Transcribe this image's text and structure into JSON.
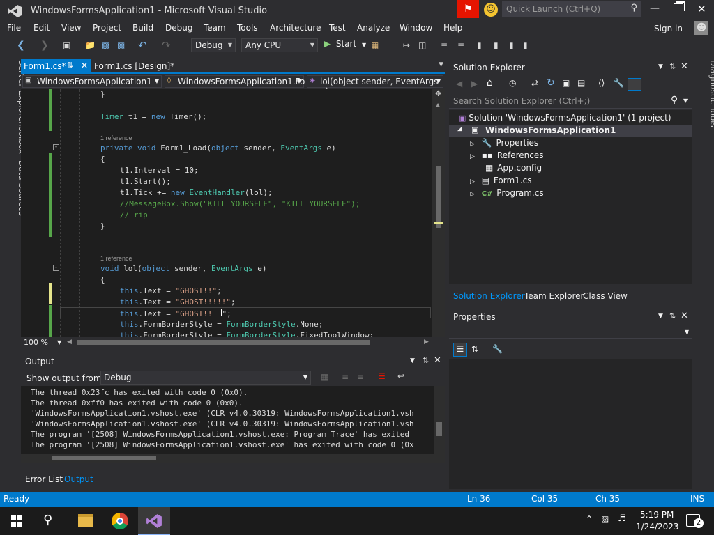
{
  "window": {
    "title": "WindowsFormsApplication1 - Microsoft Visual Studio",
    "quick_launch_placeholder": "Quick Launch (Ctrl+Q)",
    "sign_in": "Sign in"
  },
  "menu": [
    "File",
    "Edit",
    "View",
    "Project",
    "Build",
    "Debug",
    "Team",
    "Tools",
    "Architecture",
    "Test",
    "Analyze",
    "Window",
    "Help"
  ],
  "toolbar": {
    "config": "Debug",
    "platform": "Any CPU",
    "start": "Start"
  },
  "left_tabs": [
    "Server Explorer",
    "Toolbox",
    "Data Sources"
  ],
  "right_tabs": [
    "Diagnostic Tools"
  ],
  "doc_tabs": [
    {
      "label": "Form1.cs*"
    },
    {
      "label": "Form1.cs [Design]*"
    }
  ],
  "nav": {
    "project": "WindowsFormsApplication1",
    "class": "WindowsFormsApplication1.Fo",
    "member": "lol(object sender, EventArgs e)"
  },
  "code": {
    "close_brace1": "}",
    "timer_line_kw": "Timer",
    "timer_line_mid": " t1 = ",
    "timer_line_new": "new",
    "timer_line_end": " Timer();",
    "ref1": "1 reference",
    "load_private": "private",
    "load_void": "void",
    "load_name": " Form1_Load(",
    "load_object": "object",
    "load_sender": " sender, ",
    "load_eventargs": "EventArgs",
    "load_e": " e)",
    "open_brace1": "{",
    "interval": "t1.Interval = 10;",
    "start": "t1.Start();",
    "tick_a": "t1.Tick += ",
    "tick_new": "new",
    "tick_sp": " ",
    "tick_handler": "EventHandler",
    "tick_end": "(lol);",
    "comment1": "//MessageBox.Show(\"KILL YOURSELF\", \"KILL YOURSELF\");",
    "comment2": "// rip",
    "close_brace2": "}",
    "ref2": "1 reference",
    "lol_void": "void",
    "lol_name": " lol(",
    "lol_object": "object",
    "lol_sender": " sender, ",
    "lol_eventargs": "EventArgs",
    "lol_e": " e)",
    "open_brace2": "{",
    "text1_this": "this",
    "text1_mid": ".Text = ",
    "text1_str": "\"GHOST!!\"",
    "text1_end": ";",
    "text2_this": "this",
    "text2_mid": ".Text = ",
    "text2_str": "\"GHOST!!!!!\"",
    "text2_end": ";",
    "text3_this": "this",
    "text3_mid": ".Text = ",
    "text3_str": "\"GHOST!!",
    "text3_end": "\";",
    "fbs1_this": "this",
    "fbs1_mid": ".FormBorderStyle = ",
    "fbs1_type": "FormBorderStyle",
    "fbs1_end": ".None;",
    "fbs2_this": "this",
    "fbs2_mid": ".FormBorderStyle = ",
    "fbs2_type": "FormBorderStyle",
    "fbs2_end": ".FixedToolWindow;"
  },
  "zoom": "100 %",
  "output": {
    "title": "Output",
    "show_from_label": "Show output from:",
    "source": "Debug",
    "lines": [
      "The thread 0x23fc has exited with code 0 (0x0).",
      "The thread 0xff0 has exited with code 0 (0x0).",
      "'WindowsFormsApplication1.vshost.exe' (CLR v4.0.30319: WindowsFormsApplication1.vsh",
      "'WindowsFormsApplication1.vshost.exe' (CLR v4.0.30319: WindowsFormsApplication1.vsh",
      "The program '[2508] WindowsFormsApplication1.vshost.exe: Program Trace' has exited",
      "The program '[2508] WindowsFormsApplication1.vshost.exe' has exited with code 0 (0x"
    ],
    "bottom_tabs": [
      "Error List",
      "Output"
    ]
  },
  "solution_explorer": {
    "title": "Solution Explorer",
    "search_placeholder": "Search Solution Explorer (Ctrl+;)",
    "solution": "Solution 'WindowsFormsApplication1' (1 project)",
    "project": "WindowsFormsApplication1",
    "items": [
      "Properties",
      "References",
      "App.config",
      "Form1.cs",
      "Program.cs"
    ],
    "tabs": [
      "Solution Explorer",
      "Team Explorer",
      "Class View"
    ]
  },
  "properties": {
    "title": "Properties"
  },
  "status": {
    "ready": "Ready",
    "ln": "Ln 36",
    "col": "Col 35",
    "ch": "Ch 35",
    "ins": "INS"
  },
  "taskbar": {
    "time": "5:19 PM",
    "date": "1/24/2023",
    "notifications": "2"
  },
  "colors": {
    "accent": "#007acc",
    "vs_purple": "#68217a",
    "chrome_bg": "#2d2d30",
    "editor_bg": "#1e1e1e"
  }
}
